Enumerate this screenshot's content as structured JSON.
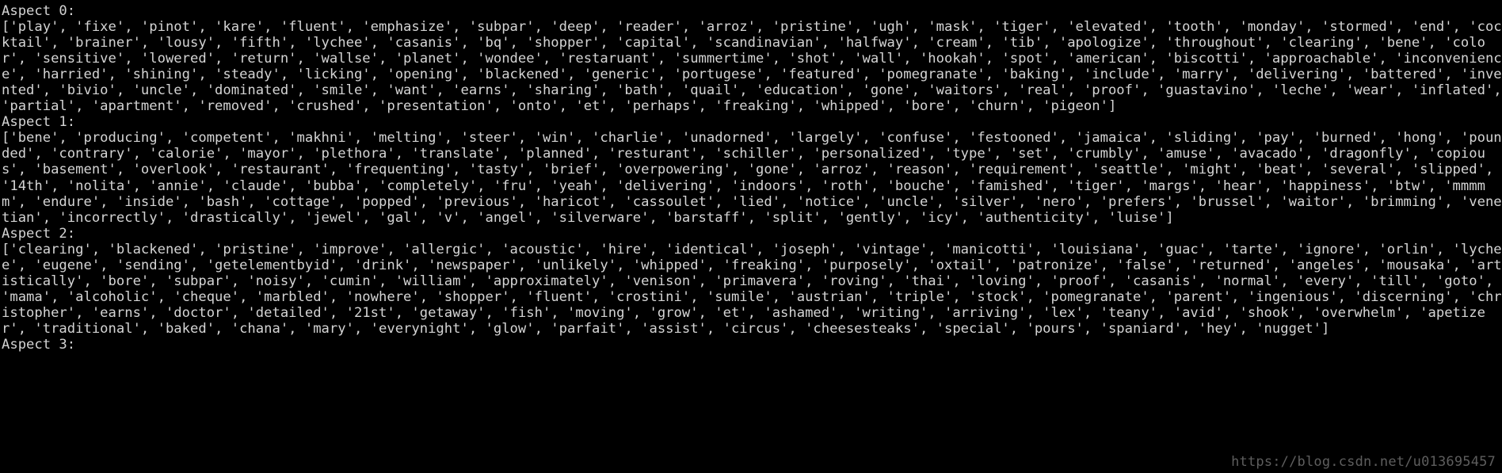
{
  "terminal": {
    "background_color": "#000000",
    "text_color": "#d4d4d4",
    "watermark_color": "#5e5e5e",
    "watermark": "https://blog.csdn.net/u013695457",
    "blocks": [
      {
        "label": "Aspect 0:",
        "list_text": "['play', 'fixe', 'pinot', 'kare', 'fluent', 'emphasize', 'subpar', 'deep', 'reader', 'arroz', 'pristine', 'ugh', 'mask', 'tiger', 'elevated', 'tooth', 'monday', 'stormed', 'end', 'cocktail', 'brainer', 'lousy', 'fifth', 'lychee', 'casanis', 'bq', 'shopper', 'capital', 'scandinavian', 'halfway', 'cream', 'tib', 'apologize', 'throughout', 'clearing', 'bene', 'color', 'sensitive', 'lowered', 'return', 'wallse', 'planet', 'wondee', 'restaruant', 'summertime', 'shot', 'wall', 'hookah', 'spot', 'american', 'biscotti', 'approachable', 'inconvenience', 'harried', 'shining', 'steady', 'licking', 'opening', 'blackened', 'generic', 'portugese', 'featured', 'pomegranate', 'baking', 'include', 'marry', 'delivering', 'battered', 'invented', 'bivio', 'uncle', 'dominated', 'smile', 'want', 'earns', 'sharing', 'bath', 'quail', 'education', 'gone', 'waitors', 'real', 'proof', 'guastavino', 'leche', 'wear', 'inflated', 'partial', 'apartment', 'removed', 'crushed', 'presentation', 'onto', 'et', 'perhaps', 'freaking', 'whipped', 'bore', 'churn', 'pigeon']"
      },
      {
        "label": "Aspect 1:",
        "list_text": "['bene', 'producing', 'competent', 'makhni', 'melting', 'steer', 'win', 'charlie', 'unadorned', 'largely', 'confuse', 'festooned', 'jamaica', 'sliding', 'pay', 'burned', 'hong', 'pounded', 'contrary', 'calorie', 'mayor', 'plethora', 'translate', 'planned', 'resturant', 'schiller', 'personalized', 'type', 'set', 'crumbly', 'amuse', 'avacado', 'dragonfly', 'copious', 'basement', 'overlook', 'restaurant', 'frequenting', 'tasty', 'brief', 'overpowering', 'gone', 'arroz', 'reason', 'requirement', 'seattle', 'might', 'beat', 'several', 'slipped', '14th', 'nolita', 'annie', 'claude', 'bubba', 'completely', 'fru', 'yeah', 'delivering', 'indoors', 'roth', 'bouche', 'famished', 'tiger', 'margs', 'hear', 'happiness', 'btw', 'mmmmm', 'endure', 'inside', 'bash', 'cottage', 'popped', 'previous', 'haricot', 'cassoulet', 'lied', 'notice', 'uncle', 'silver', 'nero', 'prefers', 'brussel', 'waitor', 'brimming', 'venetian', 'incorrectly', 'drastically', 'jewel', 'gal', 'v', 'angel', 'silverware', 'barstaff', 'split', 'gently', 'icy', 'authenticity', 'luise']"
      },
      {
        "label": "Aspect 2:",
        "list_text": "['clearing', 'blackened', 'pristine', 'improve', 'allergic', 'acoustic', 'hire', 'identical', 'joseph', 'vintage', 'manicotti', 'louisiana', 'guac', 'tarte', 'ignore', 'orlin', 'lychee', 'eugene', 'sending', 'getelementbyid', 'drink', 'newspaper', 'unlikely', 'whipped', 'freaking', 'purposely', 'oxtail', 'patronize', 'false', 'returned', 'angeles', 'mousaka', 'artistically', 'bore', 'subpar', 'noisy', 'cumin', 'william', 'approximately', 'venison', 'primavera', 'roving', 'thai', 'loving', 'proof', 'casanis', 'normal', 'every', 'till', 'goto', 'mama', 'alcoholic', 'cheque', 'marbled', 'nowhere', 'shopper', 'fluent', 'crostini', 'sumile', 'austrian', 'triple', 'stock', 'pomegranate', 'parent', 'ingenious', 'discerning', 'christopher', 'earns', 'doctor', 'detailed', '21st', 'getaway', 'fish', 'moving', 'grow', 'et', 'ashamed', 'writing', 'arriving', 'lex', 'teany', 'avid', 'shook', 'overwhelm', 'apetizer', 'traditional', 'baked', 'chana', 'mary', 'everynight', 'glow', 'parfait', 'assist', 'circus', 'cheesesteaks', 'special', 'pours', 'spaniard', 'hey', 'nugget']"
      },
      {
        "label": "Aspect 3:",
        "list_text": ""
      }
    ]
  }
}
